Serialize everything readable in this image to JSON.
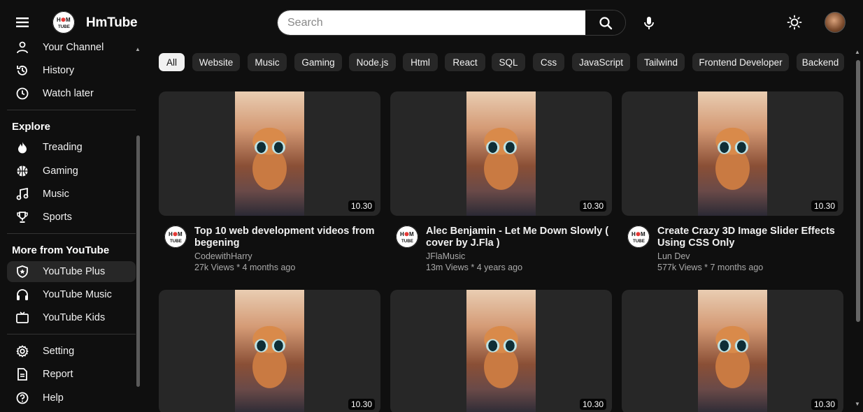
{
  "brand": {
    "name": "HmTube",
    "logo_text": "HmTube"
  },
  "search": {
    "placeholder": "Search"
  },
  "sidebar": {
    "top_items": [
      {
        "label": "Your Channel",
        "icon": "user-icon"
      },
      {
        "label": "History",
        "icon": "history-icon"
      },
      {
        "label": "Watch later",
        "icon": "clock-icon"
      }
    ],
    "explore_heading": "Explore",
    "explore_items": [
      {
        "label": "Treading",
        "icon": "fire-icon"
      },
      {
        "label": "Gaming",
        "icon": "basketball-icon"
      },
      {
        "label": "Music",
        "icon": "music-note-icon"
      },
      {
        "label": "Sports",
        "icon": "trophy-icon"
      }
    ],
    "more_heading": "More from YouTube",
    "more_items": [
      {
        "label": "YouTube Plus",
        "icon": "shield-icon",
        "active": true
      },
      {
        "label": "YouTube Music",
        "icon": "headphones-icon"
      },
      {
        "label": "YouTube Kids",
        "icon": "tv-icon"
      }
    ],
    "bottom_items": [
      {
        "label": "Setting",
        "icon": "gear-icon"
      },
      {
        "label": "Report",
        "icon": "report-icon"
      },
      {
        "label": "Help",
        "icon": "help-icon"
      }
    ]
  },
  "chips": [
    "All",
    "Website",
    "Music",
    "Gaming",
    "Node.js",
    "Html",
    "React",
    "SQL",
    "Css",
    "JavaScript",
    "Tailwind",
    "Frontend Developer",
    "Backend"
  ],
  "videos": [
    {
      "title": "Top 10 web development videos from begening",
      "channel": "CodewithHarry",
      "stats": "27k Views * 4 months ago",
      "duration": "10.30"
    },
    {
      "title": "Alec Benjamin - Let Me Down Slowly ( cover by J.Fla )",
      "channel": "JFlaMusic",
      "stats": "13m Views * 4 years ago",
      "duration": "10.30"
    },
    {
      "title": "Create Crazy 3D Image Slider Effects Using CSS Only",
      "channel": "Lun Dev",
      "stats": "577k Views * 7 months ago",
      "duration": "10.30"
    },
    {
      "title": "",
      "channel": "",
      "stats": "",
      "duration": "10.30"
    },
    {
      "title": "",
      "channel": "",
      "stats": "",
      "duration": "10.30"
    },
    {
      "title": "",
      "channel": "",
      "stats": "",
      "duration": "10.30"
    }
  ],
  "colors": {
    "background": "#0f0f0f",
    "surface": "#272727",
    "text": "#f1f1f1",
    "muted": "#aaaaaa",
    "logo_red": "#e53935"
  }
}
